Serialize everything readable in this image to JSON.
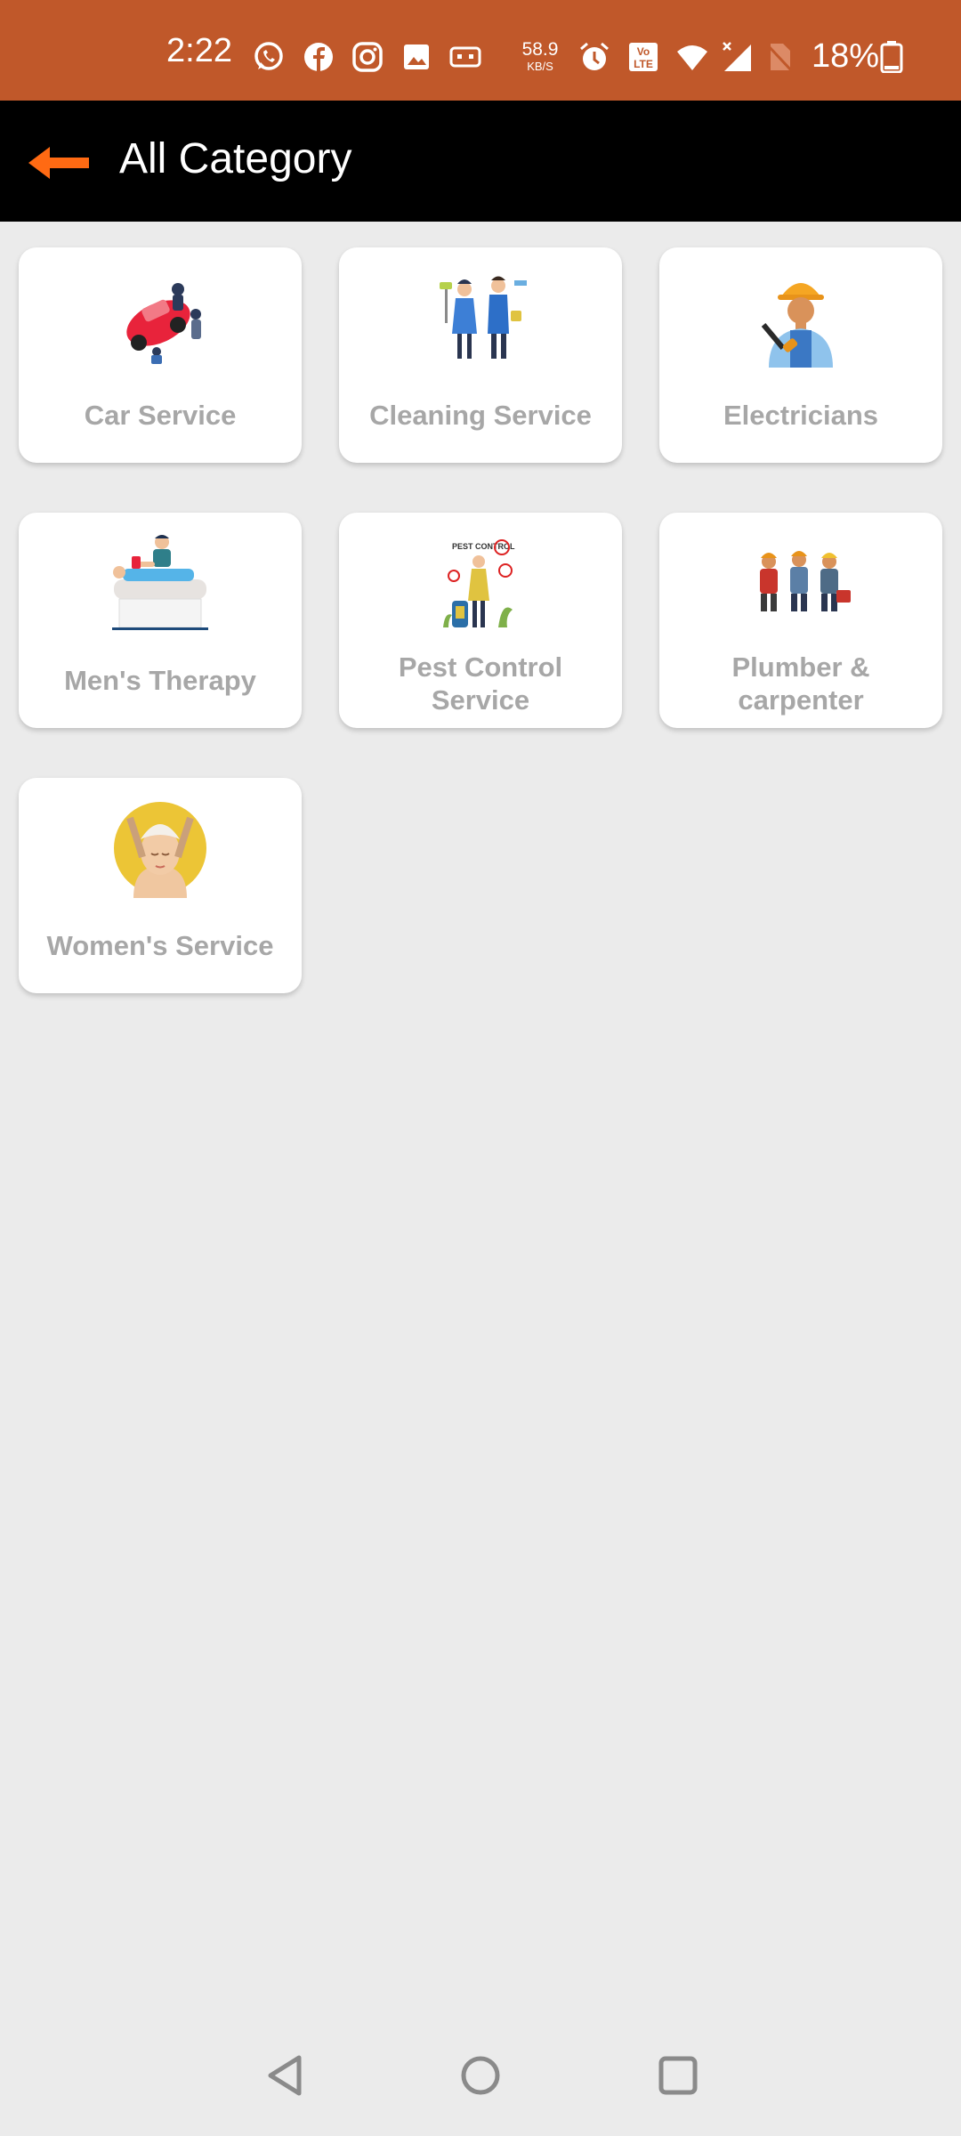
{
  "status_bar": {
    "time": "2:22",
    "net_speed_value": "58.9",
    "net_speed_unit": "KB/S",
    "battery_percent": "18%",
    "icons": [
      "whatsapp-icon",
      "facebook-icon",
      "instagram-icon",
      "gallery-icon",
      "voicemail-icon",
      "alarm-icon",
      "volte-icon",
      "wifi-icon",
      "signal-icon",
      "no-sim-icon",
      "battery-icon"
    ]
  },
  "app_bar": {
    "title": "All Category",
    "back_icon": "back-arrow-icon",
    "accent_color": "#ff6a13"
  },
  "categories": [
    {
      "label": "Car Service",
      "icon": "car-service-illustration"
    },
    {
      "label": "Cleaning Service",
      "icon": "cleaning-service-illustration"
    },
    {
      "label": "Electricians",
      "icon": "electrician-illustration"
    },
    {
      "label": "Men's Therapy",
      "icon": "mens-therapy-illustration"
    },
    {
      "label": "Pest Control Service",
      "icon": "pest-control-illustration",
      "icon_text": "PEST CONTROL"
    },
    {
      "label": "Plumber & carpenter",
      "icon": "plumber-carpenter-illustration"
    },
    {
      "label": "Women's Service",
      "icon": "womens-service-illustration"
    }
  ],
  "nav_bar": {
    "buttons": [
      "back-nav-icon",
      "home-nav-icon",
      "recents-nav-icon"
    ]
  },
  "colors": {
    "status_bar": "#c0582a",
    "app_bar": "#000000",
    "background": "#ebebeb",
    "card_label": "#a7a7a7"
  }
}
